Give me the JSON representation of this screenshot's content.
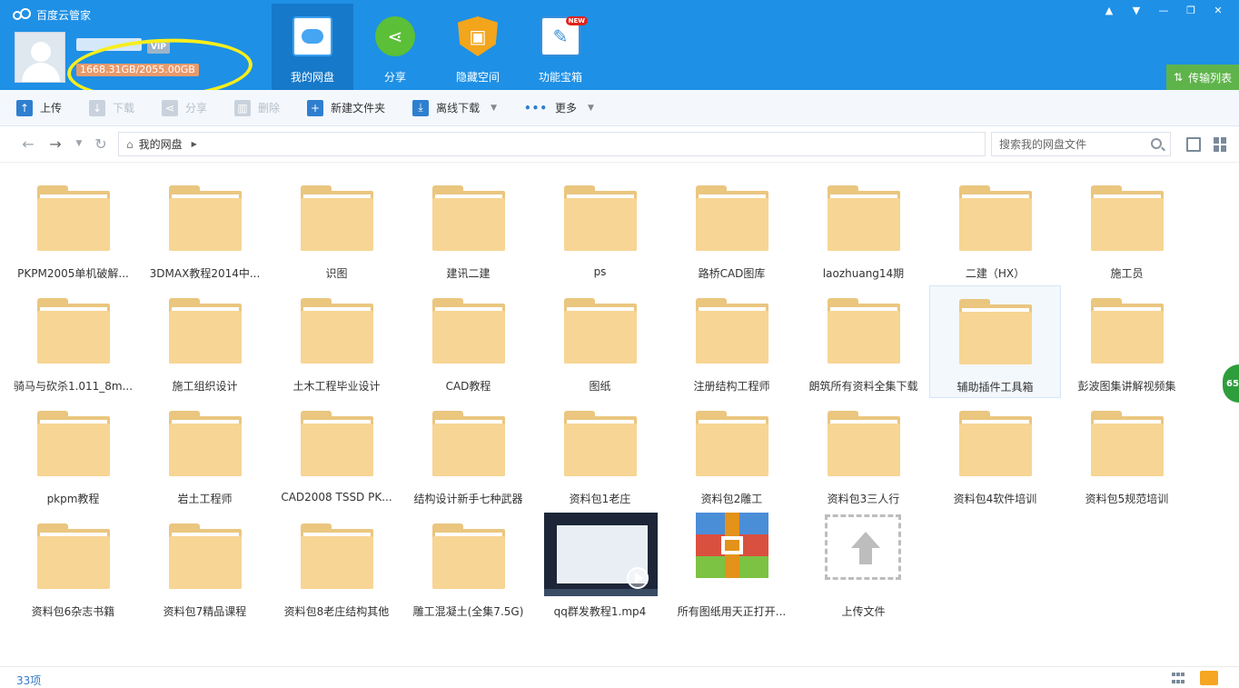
{
  "app": {
    "title": "百度云管家"
  },
  "account": {
    "vip": "VIP",
    "quota": "1668.31GB/2055.00GB"
  },
  "nav": [
    {
      "label": "我的网盘",
      "icon": "cloud-icon"
    },
    {
      "label": "分享",
      "icon": "share-icon"
    },
    {
      "label": "隐藏空间",
      "icon": "lock-icon"
    },
    {
      "label": "功能宝箱",
      "icon": "wrench-icon",
      "badge": "NEW"
    }
  ],
  "transfer": {
    "label": "传输列表"
  },
  "toolbar": [
    {
      "label": "上传",
      "icon": "upload-icon",
      "disabled": false
    },
    {
      "label": "下载",
      "icon": "download-icon",
      "disabled": true
    },
    {
      "label": "分享",
      "icon": "share-icon",
      "disabled": true
    },
    {
      "label": "删除",
      "icon": "trash-icon",
      "disabled": true
    },
    {
      "label": "新建文件夹",
      "icon": "new-folder-icon",
      "disabled": false
    },
    {
      "label": "离线下载",
      "icon": "offline-download-icon",
      "disabled": false,
      "dropdown": true
    },
    {
      "label": "更多",
      "icon": "more-icon",
      "disabled": false,
      "dropdown": true
    }
  ],
  "breadcrumb": {
    "root": "我的网盘"
  },
  "search": {
    "placeholder": "搜索我的网盘文件"
  },
  "files": [
    {
      "name": "PKPM2005单机破解...",
      "type": "folder"
    },
    {
      "name": "3DMAX教程2014中...",
      "type": "folder"
    },
    {
      "name": "识图",
      "type": "folder"
    },
    {
      "name": "建讯二建",
      "type": "folder"
    },
    {
      "name": "ps",
      "type": "folder"
    },
    {
      "name": "路桥CAD图库",
      "type": "folder"
    },
    {
      "name": "laozhuang14期",
      "type": "folder"
    },
    {
      "name": "二建（HX）",
      "type": "folder"
    },
    {
      "name": "施工员",
      "type": "folder"
    },
    {
      "name": "骑马与砍杀1.011_8m...",
      "type": "folder"
    },
    {
      "name": "施工组织设计",
      "type": "folder"
    },
    {
      "name": "土木工程毕业设计",
      "type": "folder"
    },
    {
      "name": "CAD教程",
      "type": "folder"
    },
    {
      "name": "图纸",
      "type": "folder"
    },
    {
      "name": "注册结构工程师",
      "type": "folder"
    },
    {
      "name": "朗筑所有资料全集下载",
      "type": "folder"
    },
    {
      "name": "辅助插件工具箱",
      "type": "folder",
      "selected": true
    },
    {
      "name": "彭波图集讲解视频集",
      "type": "folder"
    },
    {
      "name": "pkpm教程",
      "type": "folder"
    },
    {
      "name": "岩土工程师",
      "type": "folder"
    },
    {
      "name": "CAD2008 TSSD  PK...",
      "type": "folder"
    },
    {
      "name": "结构设计新手七种武器",
      "type": "folder"
    },
    {
      "name": "资料包1老庄",
      "type": "folder"
    },
    {
      "name": "资料包2雕工",
      "type": "folder"
    },
    {
      "name": "资料包3三人行",
      "type": "folder"
    },
    {
      "name": "资料包4软件培训",
      "type": "folder"
    },
    {
      "name": "资料包5规范培训",
      "type": "folder"
    },
    {
      "name": "资料包6杂志书籍",
      "type": "folder"
    },
    {
      "name": "资料包7精品课程",
      "type": "folder"
    },
    {
      "name": "资料包8老庄结构其他",
      "type": "folder"
    },
    {
      "name": "雕工混凝土(全集7.5G)",
      "type": "folder"
    },
    {
      "name": "qq群发教程1.mp4",
      "type": "video"
    },
    {
      "name": "所有图纸用天正打开...",
      "type": "archive"
    },
    {
      "name": "上传文件",
      "type": "upload"
    }
  ],
  "status": {
    "count": "33项"
  },
  "side": {
    "badge": "65"
  },
  "colors": {
    "header": "#1e90e6",
    "folder": "#f7d594",
    "transfer": "#5eb44a",
    "highlight": "#f7ee1c"
  }
}
